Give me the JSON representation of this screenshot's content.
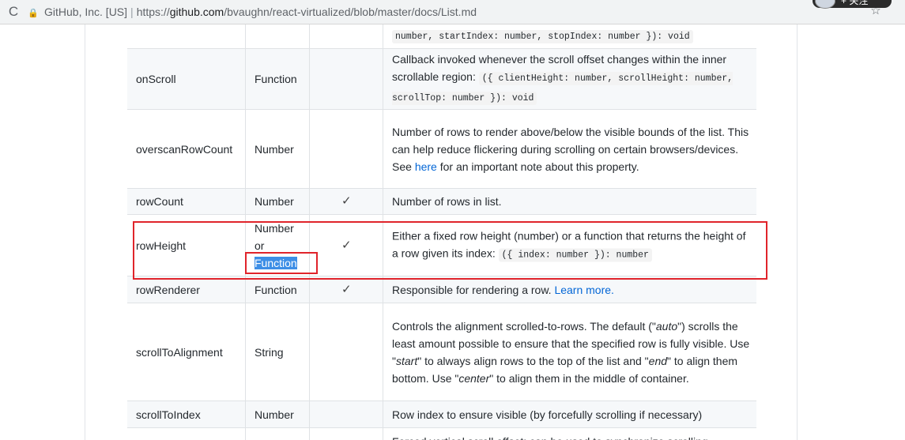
{
  "browser": {
    "reload_icon": "reload-icon",
    "organization": "GitHub, Inc. [US]",
    "separator": "|",
    "url_scheme": "https://",
    "url_host": "github.com",
    "url_path": "/bvaughn/react-virtualized/blob/master/docs/List.md",
    "overlay_text": "+ 关注"
  },
  "table": {
    "partial_top": {
      "description_code": "number, startIndex: number, stopIndex: number }): void"
    },
    "rows": [
      {
        "property": "onScroll",
        "type": "Function",
        "required": "",
        "desc_text": "Callback invoked whenever the scroll offset changes within the inner scrollable region:",
        "desc_code": "({ clientHeight: number, scrollHeight: number, scrollTop: number }): void"
      },
      {
        "property": "overscanRowCount",
        "type": "Number",
        "required": "",
        "desc_before": "Number of rows to render above/below the visible bounds of the list. This can help reduce flickering during scrolling on certain browsers/devices. See",
        "desc_link": "here",
        "desc_after": "for an important note about this property."
      },
      {
        "property": "rowCount",
        "type": "Number",
        "required": "✓",
        "desc_text": "Number of rows in list."
      },
      {
        "property": "rowHeight",
        "type_line1": "Number",
        "type_line2": "or",
        "type_line3": "Function",
        "required": "✓",
        "desc_text": "Either a fixed row height (number) or a function that returns the height of a row given its index:",
        "desc_code": "({ index: number }): number"
      },
      {
        "property": "rowRenderer",
        "type": "Function",
        "required": "✓",
        "desc_text": "Responsible for rendering a row.",
        "desc_link": "Learn more."
      },
      {
        "property": "scrollToAlignment",
        "type": "String",
        "required": "",
        "desc_p1": "Controls the alignment scrolled-to-rows. The default (\"",
        "desc_auto": "auto",
        "desc_p2": "\") scrolls the least amount possible to ensure that the specified row is fully visible. Use \"",
        "desc_start": "start",
        "desc_p3": "\" to always align rows to the top of the list and \"",
        "desc_end": "end",
        "desc_p4": "\" to align them bottom. Use \"",
        "desc_center": "center",
        "desc_p5": "\" to align them in the middle of container."
      },
      {
        "property": "scrollToIndex",
        "type": "Number",
        "required": "",
        "desc_text": "Row index to ensure visible (by forcefully scrolling if necessary)"
      }
    ],
    "partial_bottom": {
      "desc_text": "Forced vertical scroll offset; can be used to synchronize scrolling"
    }
  },
  "annotations": {
    "color": "#e0242b"
  }
}
